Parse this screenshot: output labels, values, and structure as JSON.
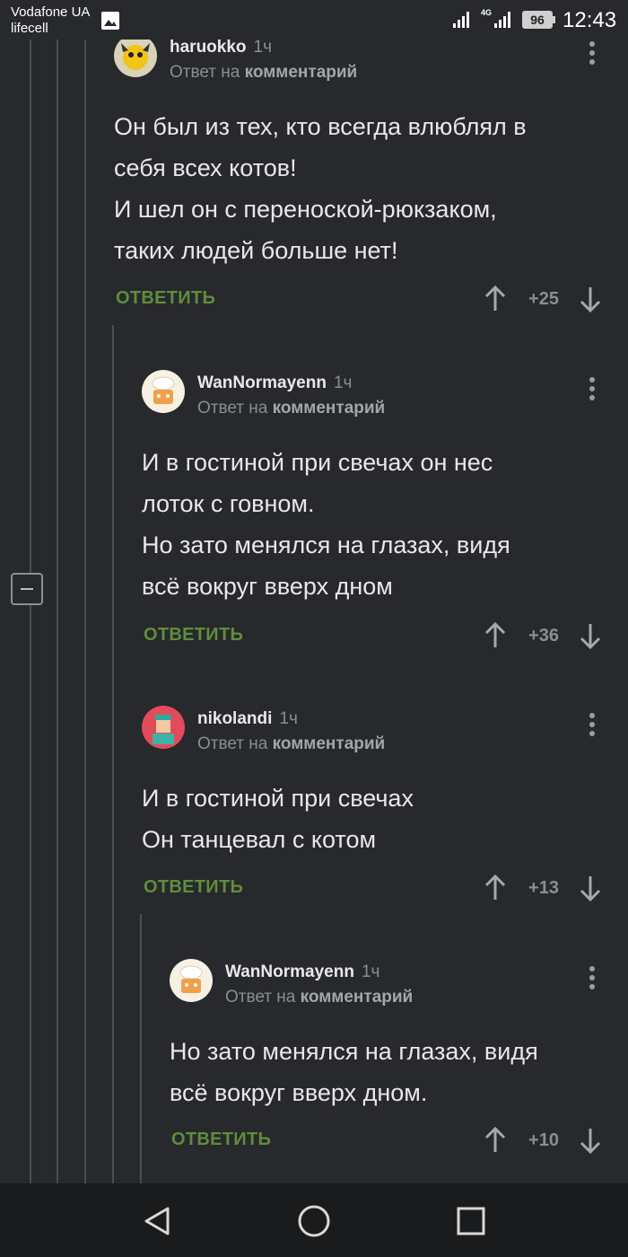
{
  "status_bar": {
    "carrier_1": "Vodafone UA",
    "carrier_2": "lifecell",
    "network": "4G",
    "battery": "96",
    "time": "12:43"
  },
  "reply_prefix": "Ответ на",
  "reply_target": "комментарий",
  "reply_label": "ОТВЕТИТЬ",
  "comments": [
    {
      "username": "haruokko",
      "time": "1ч",
      "lines": [
        "Он был из тех, кто всегда влюблял в",
        "себя всех котов!",
        "И шел он с переноской-рюкзаком,",
        "таких людей больше нет!"
      ],
      "rating": "+25"
    },
    {
      "username": "WanNormayenn",
      "time": "1ч",
      "lines": [
        "И в гостиной при свечах он нес",
        "лоток с говном.",
        "Но зато менялся на глазах, видя",
        "всё вокруг вверх дном"
      ],
      "rating": "+36"
    },
    {
      "username": "nikolandi",
      "time": "1ч",
      "lines": [
        "И в гостиной при свечах",
        "Он танцевал с котом"
      ],
      "rating": "+13"
    },
    {
      "username": "WanNormayenn",
      "time": "1ч",
      "lines": [
        "Но зато менялся на глазах, видя",
        "всё вокруг вверх дном."
      ],
      "rating": "+10"
    }
  ],
  "colors": {
    "background": "#27292c",
    "accent_reply": "#5f8d3c",
    "muted_text": "#8a8d91",
    "nav_bar": "#1a1b1d"
  },
  "icons": {
    "gallery": "image-icon",
    "signal": "signal-bars-icon",
    "battery": "battery-icon",
    "menu": "more-vertical-icon",
    "upvote": "arrow-up-icon",
    "downvote": "arrow-down-icon",
    "collapse": "minus-square-icon",
    "nav_back": "triangle-back-icon",
    "nav_home": "circle-home-icon",
    "nav_recent": "square-recent-icon"
  }
}
